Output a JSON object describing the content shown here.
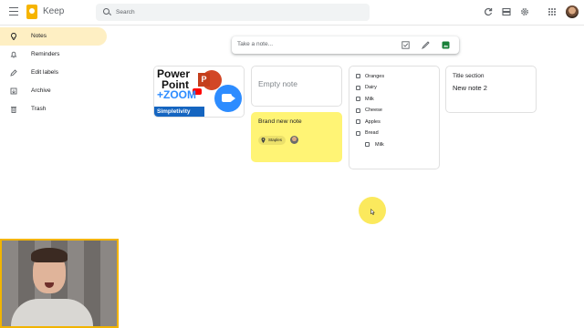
{
  "app": {
    "name": "Keep"
  },
  "search": {
    "placeholder": "Search"
  },
  "sidebar": {
    "items": [
      {
        "label": "Notes",
        "icon": "lightbulb-icon",
        "active": true
      },
      {
        "label": "Reminders",
        "icon": "bell-icon",
        "active": false
      },
      {
        "label": "Edit labels",
        "icon": "pencil-icon",
        "active": false
      },
      {
        "label": "Archive",
        "icon": "archive-icon",
        "active": false
      },
      {
        "label": "Trash",
        "icon": "trash-icon",
        "active": false
      }
    ]
  },
  "take_note": {
    "placeholder": "Take a note..."
  },
  "notes": {
    "image_note": {
      "line1": "Power",
      "line2": "Point",
      "line3": "+",
      "zoom": "ZOOM",
      "brand": "Simpletivity"
    },
    "empty_note": {
      "title": "Empty note"
    },
    "brand_note": {
      "title": "Brand new note",
      "label": "Staples",
      "color": "#fff475"
    },
    "checklist": {
      "items": [
        {
          "text": "Oranges",
          "indent": false
        },
        {
          "text": "Dairy",
          "indent": false
        },
        {
          "text": "Milk",
          "indent": false
        },
        {
          "text": "Cheese",
          "indent": false
        },
        {
          "text": "Apples",
          "indent": false
        },
        {
          "text": "Bread",
          "indent": false
        },
        {
          "text": "Milk",
          "indent": true
        }
      ]
    },
    "title_note": {
      "title": "Title section",
      "body": "New note 2"
    }
  },
  "colors": {
    "accent": "#f6b400",
    "active_nav": "#feefc3",
    "note_yellow": "#fff475"
  }
}
